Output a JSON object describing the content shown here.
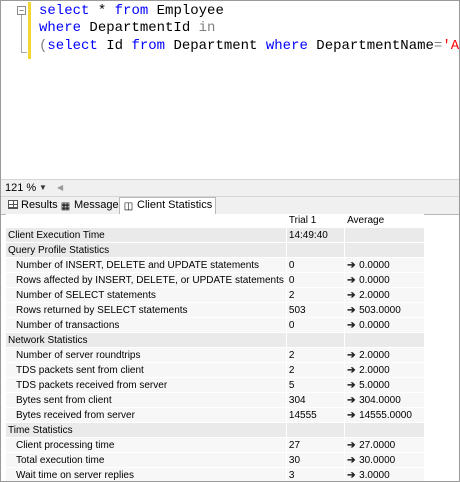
{
  "editor": {
    "lines": [
      {
        "kw1": "select",
        "plain1": " * ",
        "kw2": "from",
        "plain2": " Employee"
      },
      {
        "kw1": "where",
        "plain1": " DepartmentId ",
        "gray1": "in"
      },
      {
        "gray1": "(",
        "kw1": "select",
        "plain1": " Id ",
        "kw2": "from",
        "plain2": " Department ",
        "kw3": "where",
        "plain3": " DepartmentName",
        "gray2": "=",
        "str1": "'Account'",
        "gray3": ");"
      }
    ]
  },
  "zoom": {
    "value": "121 %"
  },
  "tabs": [
    {
      "label": "Results",
      "icon": "grid-icon"
    },
    {
      "label": "Messages",
      "icon": "messages-icon"
    },
    {
      "label": "Client Statistics",
      "icon": "client-statistics-icon"
    }
  ],
  "stats": {
    "headers": {
      "trial": "Trial  1",
      "average": "Average"
    },
    "execution_time": {
      "label": "Client Execution Time",
      "value": "14:49:40"
    },
    "sections": [
      {
        "title": "Query Profile Statistics",
        "rows": [
          {
            "label": "Number of INSERT, DELETE and UPDATE statements",
            "trial": "0",
            "average": "0.0000"
          },
          {
            "label": "Rows affected by INSERT, DELETE, or UPDATE statements",
            "trial": "0",
            "average": "0.0000"
          },
          {
            "label": "Number of SELECT statements",
            "trial": "2",
            "average": "2.0000"
          },
          {
            "label": "Rows returned by SELECT statements",
            "trial": "503",
            "average": "503.0000"
          },
          {
            "label": "Number of transactions",
            "trial": "0",
            "average": "0.0000"
          }
        ]
      },
      {
        "title": "Network Statistics",
        "rows": [
          {
            "label": "Number of server roundtrips",
            "trial": "2",
            "average": "2.0000"
          },
          {
            "label": "TDS packets sent from client",
            "trial": "2",
            "average": "2.0000"
          },
          {
            "label": "TDS packets received from server",
            "trial": "5",
            "average": "5.0000"
          },
          {
            "label": "Bytes sent from client",
            "trial": "304",
            "average": "304.0000"
          },
          {
            "label": "Bytes received from server",
            "trial": "14555",
            "average": "14555.0000"
          }
        ]
      },
      {
        "title": "Time Statistics",
        "rows": [
          {
            "label": "Client processing time",
            "trial": "27",
            "average": "27.0000"
          },
          {
            "label": "Total execution time",
            "trial": "30",
            "average": "30.0000"
          },
          {
            "label": "Wait time on server replies",
            "trial": "3",
            "average": "3.0000"
          }
        ]
      }
    ]
  }
}
